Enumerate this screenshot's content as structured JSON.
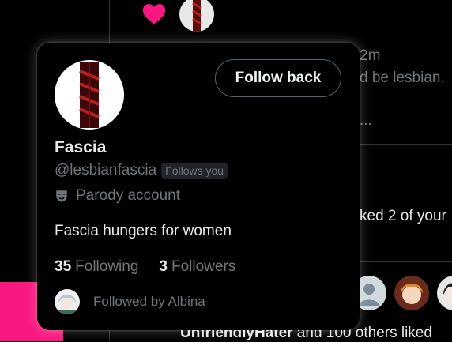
{
  "background": {
    "time": "2m",
    "post_snippet": "d be lesbian.",
    "ellipsis": "...",
    "notification_snippet": "ked 2 of your",
    "liker_snippet": "UnfriendlyHater",
    "liker_rest": " and 100 others liked"
  },
  "hover_card": {
    "follow_button": "Follow back",
    "name": "Fascia",
    "handle": "@lesbianfascia",
    "follows_you_badge": "Follows you",
    "parody_label": "Parody account",
    "bio": "Fascia hungers for women",
    "following_count": "35",
    "following_label": "Following",
    "followers_count": "3",
    "followers_label": "Followers",
    "followed_by": "Followed by Albina"
  },
  "colors": {
    "like_pink": "#f91880",
    "secondary_text": "#71767b",
    "primary_text": "#e7e9ea",
    "border": "#536471"
  },
  "icons": {
    "like": "heart-icon",
    "parody": "theater-mask-icon"
  }
}
